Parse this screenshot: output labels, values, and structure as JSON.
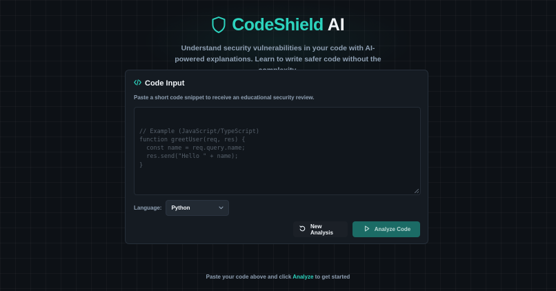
{
  "brand": {
    "name": "CodeShield",
    "suffix": "AI",
    "icon": "shield-icon",
    "accent_color": "#2dd4bf"
  },
  "subtitle": "Understand security vulnerabilities in your code with AI-powered explanations. Learn to write safer code without the complexity.",
  "card": {
    "title": "Code Input",
    "title_icon": "code-icon",
    "description": "Paste a short code snippet to receive an educational security review.",
    "editor": {
      "value": "",
      "placeholder": "// Example (JavaScript/TypeScript)\nfunction greetUser(req, res) {\n  const name = req.query.name;\n  res.send(\"Hello \" + name);\n}"
    },
    "language": {
      "label": "Language:",
      "selected": "Python",
      "icon": "chevron-down-icon"
    },
    "buttons": {
      "new_analysis": {
        "label": "New Analysis",
        "icon": "refresh-icon"
      },
      "analyze": {
        "label": "Analyze Code",
        "icon": "play-icon",
        "color": "#1b6b65"
      }
    }
  },
  "footer": {
    "hint_before": "Paste your code above and click ",
    "hint_accent": "Analyze",
    "hint_after": " to get started"
  }
}
